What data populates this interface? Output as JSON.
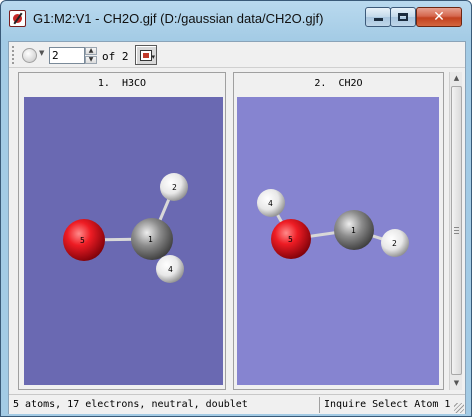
{
  "window": {
    "title": "G1:M2:V1 - CH2O.gjf (D:/gaussian data/CH2O.gjf)",
    "close_label": "✕"
  },
  "toolbar": {
    "molecule_number": "2",
    "of_label": "of",
    "total_molecules": "2"
  },
  "panels": [
    {
      "label": "1.  H3CO",
      "atoms": [
        {
          "id": "5",
          "element": "O"
        },
        {
          "id": "1",
          "element": "C"
        },
        {
          "id": "2",
          "element": "H"
        },
        {
          "id": "4",
          "element": "H"
        }
      ]
    },
    {
      "label": "2.  CH2O",
      "atoms": [
        {
          "id": "4",
          "element": "H"
        },
        {
          "id": "5",
          "element": "O"
        },
        {
          "id": "1",
          "element": "C"
        },
        {
          "id": "2",
          "element": "H"
        }
      ]
    }
  ],
  "status": {
    "info": "5 atoms, 17 electrons, neutral, doublet",
    "mode": "Inquire Select Atom 1"
  },
  "colors": {
    "viewport_1_bg": "#6a69b2",
    "viewport_2_bg": "#8684d0",
    "oxygen": "#e8141c",
    "carbon": "#8a8a8a",
    "hydrogen": "#f2f2f2"
  },
  "icons": {
    "app": "gaussview-app-icon",
    "view": "view-toggle-icon"
  }
}
